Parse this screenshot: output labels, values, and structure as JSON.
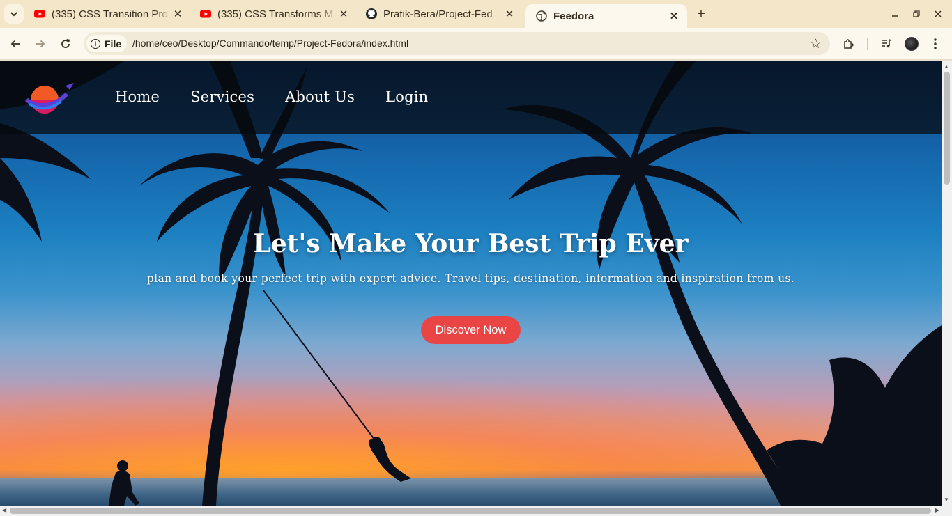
{
  "browser": {
    "tabs": [
      {
        "title": "(335) CSS Transition Pro",
        "favicon": "youtube-icon"
      },
      {
        "title": "(335) CSS Transforms M",
        "favicon": "youtube-icon"
      },
      {
        "title": "Pratik-Bera/Project-Fed",
        "favicon": "github-icon"
      },
      {
        "title": "Feedora",
        "favicon": "globe-icon",
        "active": true
      }
    ],
    "site_info_label": "File",
    "url": "/home/ceo/Desktop/Commando/temp/Project-Fedora/index.html"
  },
  "page": {
    "nav": [
      "Home",
      "Services",
      "About Us",
      "Login"
    ],
    "hero_title": "Let's Make Your Best Trip Ever",
    "hero_subtitle": "plan and book your perfect trip with expert advice. Travel tips, destination, information and inspiration from us.",
    "cta_label": "Discover Now",
    "colors": {
      "cta": "#e94545",
      "nav_overlay": "#05080e"
    }
  }
}
